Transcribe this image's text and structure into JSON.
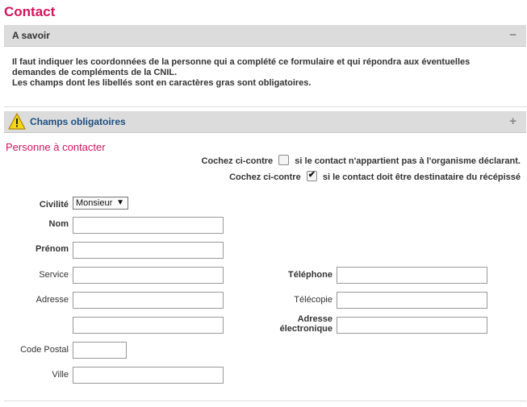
{
  "page": {
    "title": "Contact"
  },
  "a_savoir": {
    "title": "A savoir",
    "toggle": "−",
    "lines": [
      "Il faut indiquer les coordonnées de la personne qui a complété ce formulaire et qui répondra aux éventuelles",
      "demandes de compléments de la CNIL.",
      "Les champs dont les libellés sont en caractères gras sont obligatoires."
    ]
  },
  "champs": {
    "title": "Champs obligatoires",
    "toggle": "+",
    "icon": "warning-icon"
  },
  "section": {
    "title": "Personne à contacter"
  },
  "checkboxes": [
    {
      "prefix": "Cochez ci-contre",
      "suffix": "si le contact n'appartient pas à l'organisme déclarant.",
      "checked": false
    },
    {
      "prefix": "Cochez ci-contre",
      "suffix": "si le contact doit être destinataire du récépissé",
      "checked": true
    }
  ],
  "form": {
    "civilite_label": "Civilité",
    "civilite_value": "Monsieur",
    "nom_label": "Nom",
    "prenom_label": "Prénom",
    "service_label": "Service",
    "adresse_label": "Adresse",
    "code_postal_label": "Code Postal",
    "ville_label": "Ville",
    "telephone_label": "Téléphone",
    "telecopie_label": "Télécopie",
    "email_label_1": "Adresse",
    "email_label_2": "électronique"
  }
}
